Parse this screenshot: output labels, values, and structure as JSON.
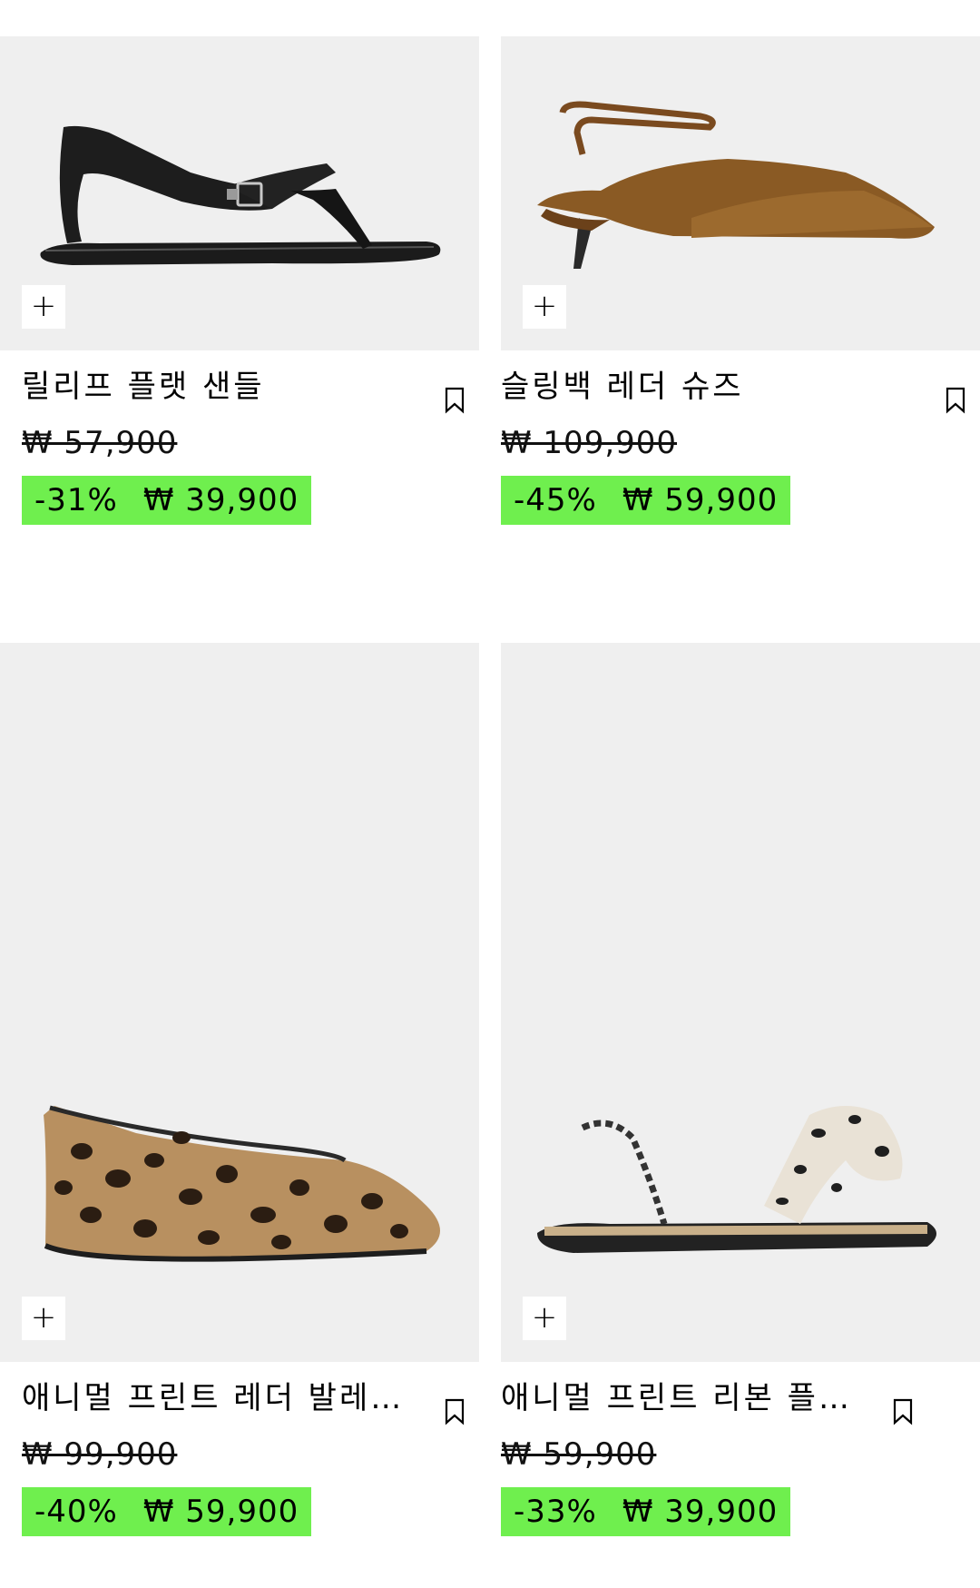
{
  "products": [
    {
      "name": "릴리프 플랫 샌들",
      "old_price": "₩ 57,900",
      "discount": "-31%",
      "sale_price": "₩ 39,900",
      "image": "black-croc-thong-sandal"
    },
    {
      "name": "슬링백 레더 슈즈",
      "old_price": "₩ 109,900",
      "discount": "-45%",
      "sale_price": "₩ 59,900",
      "image": "brown-slingback-kitten-heel"
    },
    {
      "name": "애니멀 프린트 레더 발레…",
      "old_price": "₩ 99,900",
      "discount": "-40%",
      "sale_price": "₩ 59,900",
      "image": "leopard-ballet-flat"
    },
    {
      "name": "애니멀 프린트 리본 플…",
      "old_price": "₩ 59,900",
      "discount": "-33%",
      "sale_price": "₩ 39,900",
      "image": "leopard-bow-sandal"
    }
  ],
  "icons": {
    "add": "plus-icon",
    "save": "bookmark-icon"
  },
  "colors": {
    "sale_highlight": "#6fef4e",
    "image_bg": "#efefef"
  }
}
